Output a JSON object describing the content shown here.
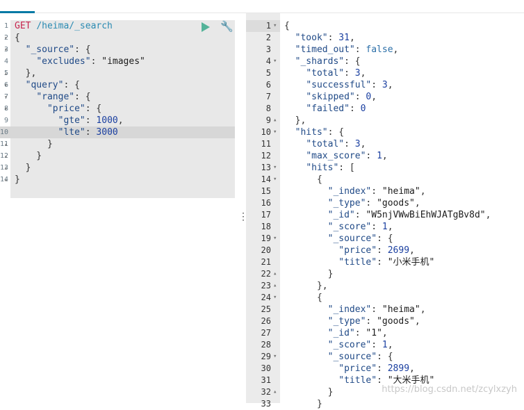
{
  "request": {
    "method": "GET",
    "url": "/heima/_search",
    "lines": [
      {
        "n": "1",
        "fold": "",
        "parts": [
          {
            "t": "method",
            "v": "GET"
          },
          {
            "t": "punc",
            "v": " "
          },
          {
            "t": "url",
            "v": "/heima/_search"
          }
        ]
      },
      {
        "n": "2",
        "fold": "▾",
        "parts": [
          {
            "t": "punc",
            "v": "{"
          }
        ]
      },
      {
        "n": "3",
        "fold": "▾",
        "parts": [
          {
            "t": "punc",
            "v": "  "
          },
          {
            "t": "key",
            "v": "\"_source\""
          },
          {
            "t": "punc",
            "v": ": {"
          }
        ]
      },
      {
        "n": "4",
        "fold": "",
        "parts": [
          {
            "t": "punc",
            "v": "    "
          },
          {
            "t": "key",
            "v": "\"excludes\""
          },
          {
            "t": "punc",
            "v": ": "
          },
          {
            "t": "str",
            "v": "\"images\""
          }
        ]
      },
      {
        "n": "5",
        "fold": "▴",
        "parts": [
          {
            "t": "punc",
            "v": "  },"
          }
        ]
      },
      {
        "n": "6",
        "fold": "▾",
        "parts": [
          {
            "t": "punc",
            "v": "  "
          },
          {
            "t": "key",
            "v": "\"query\""
          },
          {
            "t": "punc",
            "v": ": {"
          }
        ]
      },
      {
        "n": "7",
        "fold": "▾",
        "parts": [
          {
            "t": "punc",
            "v": "    "
          },
          {
            "t": "key",
            "v": "\"range\""
          },
          {
            "t": "punc",
            "v": ": {"
          }
        ]
      },
      {
        "n": "8",
        "fold": "▾",
        "parts": [
          {
            "t": "punc",
            "v": "      "
          },
          {
            "t": "key",
            "v": "\"price\""
          },
          {
            "t": "punc",
            "v": ": {"
          }
        ]
      },
      {
        "n": "9",
        "fold": "",
        "parts": [
          {
            "t": "punc",
            "v": "        "
          },
          {
            "t": "key",
            "v": "\"gte\""
          },
          {
            "t": "punc",
            "v": ": "
          },
          {
            "t": "num",
            "v": "1000"
          },
          {
            "t": "punc",
            "v": ","
          }
        ]
      },
      {
        "n": "10",
        "fold": "",
        "hl": true,
        "parts": [
          {
            "t": "punc",
            "v": "        "
          },
          {
            "t": "key",
            "v": "\"lte\""
          },
          {
            "t": "punc",
            "v": ": "
          },
          {
            "t": "num",
            "v": "3000"
          }
        ]
      },
      {
        "n": "11",
        "fold": "▴",
        "parts": [
          {
            "t": "punc",
            "v": "      }"
          }
        ]
      },
      {
        "n": "12",
        "fold": "▴",
        "parts": [
          {
            "t": "punc",
            "v": "    }"
          }
        ]
      },
      {
        "n": "13",
        "fold": "▴",
        "parts": [
          {
            "t": "punc",
            "v": "  }"
          }
        ]
      },
      {
        "n": "14",
        "fold": "▴",
        "parts": [
          {
            "t": "punc",
            "v": "}"
          }
        ]
      }
    ]
  },
  "toolbar": {
    "play_icon": "play-icon",
    "wrench_icon": "wrench-icon"
  },
  "response": {
    "lines": [
      {
        "n": "1",
        "fold": "▾",
        "parts": [
          {
            "t": "punc",
            "v": "{"
          }
        ]
      },
      {
        "n": "2",
        "fold": "",
        "parts": [
          {
            "t": "punc",
            "v": "  "
          },
          {
            "t": "key",
            "v": "\"took\""
          },
          {
            "t": "punc",
            "v": ": "
          },
          {
            "t": "num",
            "v": "31"
          },
          {
            "t": "punc",
            "v": ","
          }
        ]
      },
      {
        "n": "3",
        "fold": "",
        "parts": [
          {
            "t": "punc",
            "v": "  "
          },
          {
            "t": "key",
            "v": "\"timed_out\""
          },
          {
            "t": "punc",
            "v": ": "
          },
          {
            "t": "bool",
            "v": "false"
          },
          {
            "t": "punc",
            "v": ","
          }
        ]
      },
      {
        "n": "4",
        "fold": "▾",
        "parts": [
          {
            "t": "punc",
            "v": "  "
          },
          {
            "t": "key",
            "v": "\"_shards\""
          },
          {
            "t": "punc",
            "v": ": {"
          }
        ]
      },
      {
        "n": "5",
        "fold": "",
        "parts": [
          {
            "t": "punc",
            "v": "    "
          },
          {
            "t": "key",
            "v": "\"total\""
          },
          {
            "t": "punc",
            "v": ": "
          },
          {
            "t": "num",
            "v": "3"
          },
          {
            "t": "punc",
            "v": ","
          }
        ]
      },
      {
        "n": "6",
        "fold": "",
        "parts": [
          {
            "t": "punc",
            "v": "    "
          },
          {
            "t": "key",
            "v": "\"successful\""
          },
          {
            "t": "punc",
            "v": ": "
          },
          {
            "t": "num",
            "v": "3"
          },
          {
            "t": "punc",
            "v": ","
          }
        ]
      },
      {
        "n": "7",
        "fold": "",
        "parts": [
          {
            "t": "punc",
            "v": "    "
          },
          {
            "t": "key",
            "v": "\"skipped\""
          },
          {
            "t": "punc",
            "v": ": "
          },
          {
            "t": "num",
            "v": "0"
          },
          {
            "t": "punc",
            "v": ","
          }
        ]
      },
      {
        "n": "8",
        "fold": "",
        "parts": [
          {
            "t": "punc",
            "v": "    "
          },
          {
            "t": "key",
            "v": "\"failed\""
          },
          {
            "t": "punc",
            "v": ": "
          },
          {
            "t": "num",
            "v": "0"
          }
        ]
      },
      {
        "n": "9",
        "fold": "▴",
        "parts": [
          {
            "t": "punc",
            "v": "  },"
          }
        ]
      },
      {
        "n": "10",
        "fold": "▾",
        "parts": [
          {
            "t": "punc",
            "v": "  "
          },
          {
            "t": "key",
            "v": "\"hits\""
          },
          {
            "t": "punc",
            "v": ": {"
          }
        ]
      },
      {
        "n": "11",
        "fold": "",
        "parts": [
          {
            "t": "punc",
            "v": "    "
          },
          {
            "t": "key",
            "v": "\"total\""
          },
          {
            "t": "punc",
            "v": ": "
          },
          {
            "t": "num",
            "v": "3"
          },
          {
            "t": "punc",
            "v": ","
          }
        ]
      },
      {
        "n": "12",
        "fold": "",
        "parts": [
          {
            "t": "punc",
            "v": "    "
          },
          {
            "t": "key",
            "v": "\"max_score\""
          },
          {
            "t": "punc",
            "v": ": "
          },
          {
            "t": "num",
            "v": "1"
          },
          {
            "t": "punc",
            "v": ","
          }
        ]
      },
      {
        "n": "13",
        "fold": "▾",
        "parts": [
          {
            "t": "punc",
            "v": "    "
          },
          {
            "t": "key",
            "v": "\"hits\""
          },
          {
            "t": "punc",
            "v": ": ["
          }
        ]
      },
      {
        "n": "14",
        "fold": "▾",
        "parts": [
          {
            "t": "punc",
            "v": "      {"
          }
        ]
      },
      {
        "n": "15",
        "fold": "",
        "parts": [
          {
            "t": "punc",
            "v": "        "
          },
          {
            "t": "key",
            "v": "\"_index\""
          },
          {
            "t": "punc",
            "v": ": "
          },
          {
            "t": "str",
            "v": "\"heima\""
          },
          {
            "t": "punc",
            "v": ","
          }
        ]
      },
      {
        "n": "16",
        "fold": "",
        "parts": [
          {
            "t": "punc",
            "v": "        "
          },
          {
            "t": "key",
            "v": "\"_type\""
          },
          {
            "t": "punc",
            "v": ": "
          },
          {
            "t": "str",
            "v": "\"goods\""
          },
          {
            "t": "punc",
            "v": ","
          }
        ]
      },
      {
        "n": "17",
        "fold": "",
        "parts": [
          {
            "t": "punc",
            "v": "        "
          },
          {
            "t": "key",
            "v": "\"_id\""
          },
          {
            "t": "punc",
            "v": ": "
          },
          {
            "t": "str",
            "v": "\"W5njVWwBiEhWJATgBv8d\""
          },
          {
            "t": "punc",
            "v": ","
          }
        ]
      },
      {
        "n": "18",
        "fold": "",
        "parts": [
          {
            "t": "punc",
            "v": "        "
          },
          {
            "t": "key",
            "v": "\"_score\""
          },
          {
            "t": "punc",
            "v": ": "
          },
          {
            "t": "num",
            "v": "1"
          },
          {
            "t": "punc",
            "v": ","
          }
        ]
      },
      {
        "n": "19",
        "fold": "▾",
        "parts": [
          {
            "t": "punc",
            "v": "        "
          },
          {
            "t": "key",
            "v": "\"_source\""
          },
          {
            "t": "punc",
            "v": ": {"
          }
        ]
      },
      {
        "n": "20",
        "fold": "",
        "parts": [
          {
            "t": "punc",
            "v": "          "
          },
          {
            "t": "key",
            "v": "\"price\""
          },
          {
            "t": "punc",
            "v": ": "
          },
          {
            "t": "num",
            "v": "2699"
          },
          {
            "t": "punc",
            "v": ","
          }
        ]
      },
      {
        "n": "21",
        "fold": "",
        "parts": [
          {
            "t": "punc",
            "v": "          "
          },
          {
            "t": "key",
            "v": "\"title\""
          },
          {
            "t": "punc",
            "v": ": "
          },
          {
            "t": "str",
            "v": "\"小米手机\""
          }
        ]
      },
      {
        "n": "22",
        "fold": "▴",
        "parts": [
          {
            "t": "punc",
            "v": "        }"
          }
        ]
      },
      {
        "n": "23",
        "fold": "▴",
        "parts": [
          {
            "t": "punc",
            "v": "      },"
          }
        ]
      },
      {
        "n": "24",
        "fold": "▾",
        "parts": [
          {
            "t": "punc",
            "v": "      {"
          }
        ]
      },
      {
        "n": "25",
        "fold": "",
        "parts": [
          {
            "t": "punc",
            "v": "        "
          },
          {
            "t": "key",
            "v": "\"_index\""
          },
          {
            "t": "punc",
            "v": ": "
          },
          {
            "t": "str",
            "v": "\"heima\""
          },
          {
            "t": "punc",
            "v": ","
          }
        ]
      },
      {
        "n": "26",
        "fold": "",
        "parts": [
          {
            "t": "punc",
            "v": "        "
          },
          {
            "t": "key",
            "v": "\"_type\""
          },
          {
            "t": "punc",
            "v": ": "
          },
          {
            "t": "str",
            "v": "\"goods\""
          },
          {
            "t": "punc",
            "v": ","
          }
        ]
      },
      {
        "n": "27",
        "fold": "",
        "parts": [
          {
            "t": "punc",
            "v": "        "
          },
          {
            "t": "key",
            "v": "\"_id\""
          },
          {
            "t": "punc",
            "v": ": "
          },
          {
            "t": "str",
            "v": "\"1\""
          },
          {
            "t": "punc",
            "v": ","
          }
        ]
      },
      {
        "n": "28",
        "fold": "",
        "parts": [
          {
            "t": "punc",
            "v": "        "
          },
          {
            "t": "key",
            "v": "\"_score\""
          },
          {
            "t": "punc",
            "v": ": "
          },
          {
            "t": "num",
            "v": "1"
          },
          {
            "t": "punc",
            "v": ","
          }
        ]
      },
      {
        "n": "29",
        "fold": "▾",
        "parts": [
          {
            "t": "punc",
            "v": "        "
          },
          {
            "t": "key",
            "v": "\"_source\""
          },
          {
            "t": "punc",
            "v": ": {"
          }
        ]
      },
      {
        "n": "30",
        "fold": "",
        "parts": [
          {
            "t": "punc",
            "v": "          "
          },
          {
            "t": "key",
            "v": "\"price\""
          },
          {
            "t": "punc",
            "v": ": "
          },
          {
            "t": "num",
            "v": "2899"
          },
          {
            "t": "punc",
            "v": ","
          }
        ]
      },
      {
        "n": "31",
        "fold": "",
        "parts": [
          {
            "t": "punc",
            "v": "          "
          },
          {
            "t": "key",
            "v": "\"title\""
          },
          {
            "t": "punc",
            "v": ": "
          },
          {
            "t": "str",
            "v": "\"大米手机\""
          }
        ]
      },
      {
        "n": "32",
        "fold": "▴",
        "parts": [
          {
            "t": "punc",
            "v": "        }"
          }
        ]
      },
      {
        "n": "33",
        "fold": "",
        "parts": [
          {
            "t": "punc",
            "v": "      }"
          }
        ]
      }
    ]
  },
  "watermark": "https://blog.csdn.net/zcylxzyh",
  "colors": {
    "accent_tab": "#0079a5",
    "play": "#54b399"
  }
}
